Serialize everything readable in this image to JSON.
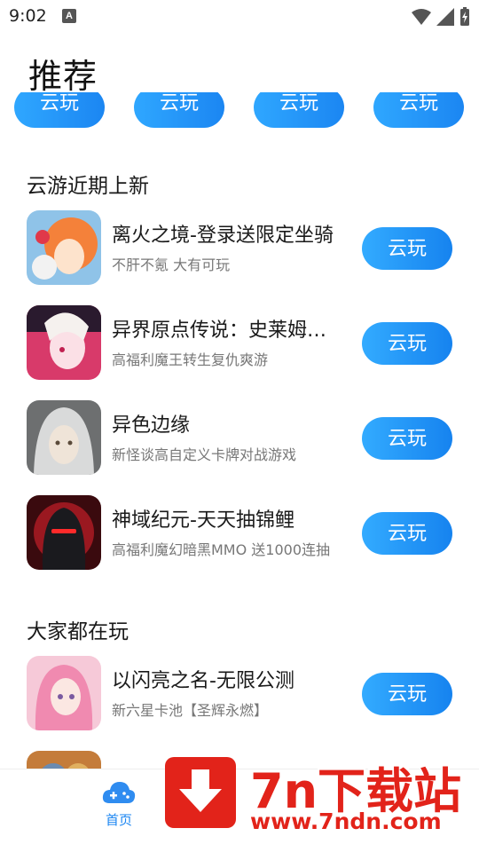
{
  "status_bar": {
    "time": "9:02",
    "notification_glyph": "A"
  },
  "page": {
    "title": "推荐"
  },
  "top_row_buttons": [
    "云玩",
    "云玩",
    "云玩",
    "云玩"
  ],
  "sections": [
    {
      "title": "云游近期上新",
      "games": [
        {
          "name": "离火之境-登录送限定坐骑",
          "desc": "不肝不氪 大有可玩",
          "button": "云玩"
        },
        {
          "name": "异界原点传说：史莱姆与魔王",
          "desc": "高福利魔王转生复仇爽游",
          "button": "云玩"
        },
        {
          "name": "异色边缘",
          "desc": "新怪谈高自定义卡牌对战游戏",
          "button": "云玩"
        },
        {
          "name": "神域纪元-天天抽锦鲤",
          "desc": "高福利魔幻暗黑MMO 送1000连抽",
          "button": "云玩"
        }
      ]
    },
    {
      "title": "大家都在玩",
      "games": [
        {
          "name": "以闪亮之名-无限公测",
          "desc": "新六星卡池【圣辉永燃】",
          "button": "云玩"
        },
        {
          "name": "...",
          "desc": "",
          "button": ""
        }
      ]
    }
  ],
  "bottom_nav": {
    "home_label": "首页"
  },
  "watermark": {
    "title": "7n下载站",
    "url": "www.7ndn.com"
  }
}
